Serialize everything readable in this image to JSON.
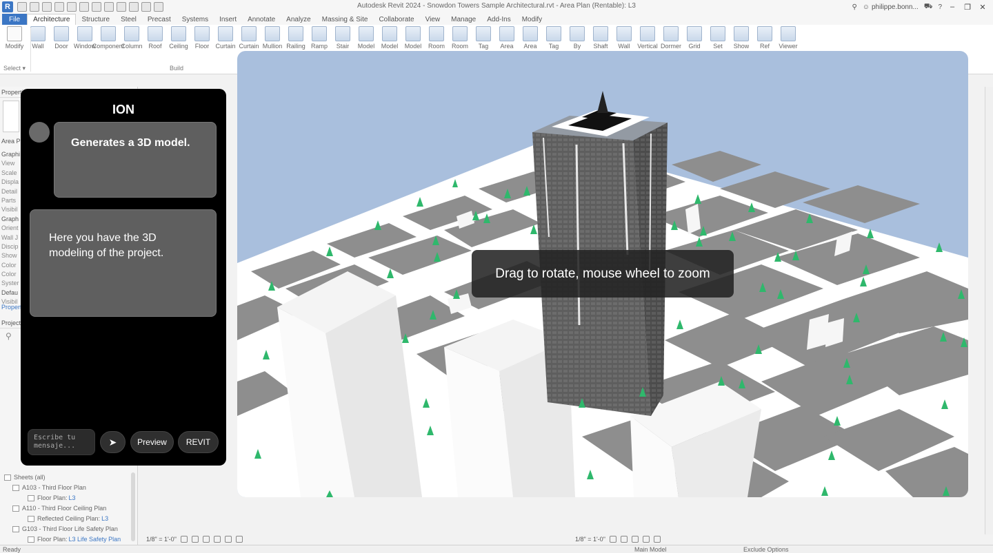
{
  "titlebar": {
    "logo_letter": "R",
    "title": "Autodesk Revit 2024 - Snowdon Towers Sample Architectural.rvt - Area Plan (Rentable): L3",
    "user": "philippe.bonn...",
    "help": "?"
  },
  "ribbon_tabs": [
    "File",
    "Architecture",
    "Structure",
    "Steel",
    "Precast",
    "Systems",
    "Insert",
    "Annotate",
    "Analyze",
    "Massing & Site",
    "Collaborate",
    "View",
    "Manage",
    "Add-Ins",
    "Modify"
  ],
  "ribbon": {
    "tools": [
      "Modify",
      "Wall",
      "Door",
      "Window",
      "Component",
      "Column",
      "Roof",
      "Ceiling",
      "Floor",
      "Curtain",
      "Curtain",
      "Mullion",
      "Railing",
      "Ramp",
      "Stair",
      "Model",
      "Model",
      "Model",
      "Room",
      "Room",
      "Tag",
      "Area",
      "Area",
      "Tag",
      "By",
      "Shaft",
      "Wall",
      "Vertical",
      "Dormer",
      "Grid",
      "Set",
      "Show",
      "Ref",
      "Viewer"
    ],
    "select_label": "Select",
    "build_label": "Build"
  },
  "properties": {
    "header": "Properti",
    "type_label": "Area P",
    "rows": [
      "Graphi",
      "View",
      "Scale",
      "Displa",
      "Detail",
      "Parts",
      "Visibil",
      "Graph",
      "Orient",
      "Wall J",
      "Discip",
      "Show",
      "Color",
      "Color",
      "Syster",
      "Defau",
      "Visibil"
    ],
    "link": "Propert"
  },
  "project_browser": {
    "header": "Project",
    "tree": [
      {
        "label": "Sheets (all)",
        "level": ""
      },
      {
        "label": "A103 - Third Floor Plan",
        "level": ""
      },
      {
        "label": "Floor Plan: ",
        "level": "L3"
      },
      {
        "label": "A110 - Third Floor Ceiling Plan",
        "level": ""
      },
      {
        "label": "Reflected Ceiling Plan: ",
        "level": "L3"
      },
      {
        "label": "G103 - Third Floor Life Safety Plan",
        "level": ""
      },
      {
        "label": "Floor Plan: ",
        "level": "L3 Life Safety Plan"
      }
    ]
  },
  "ion": {
    "title": "ION",
    "user_message": "Generates a 3D model.",
    "bot_message": "Here you have the 3D modeling of the project.",
    "input_placeholder": "Escribe tu mensaje...",
    "send_glyph": "➤",
    "preview_label": "Preview",
    "revit_label": "REVIT"
  },
  "viewport": {
    "hint": "Drag to rotate, mouse wheel to zoom"
  },
  "viewbar": {
    "scale": "1/8\" = 1'-0\""
  },
  "statusbar": {
    "ready": "Ready",
    "model": "Main Model",
    "exclude": "Exclude Options"
  }
}
